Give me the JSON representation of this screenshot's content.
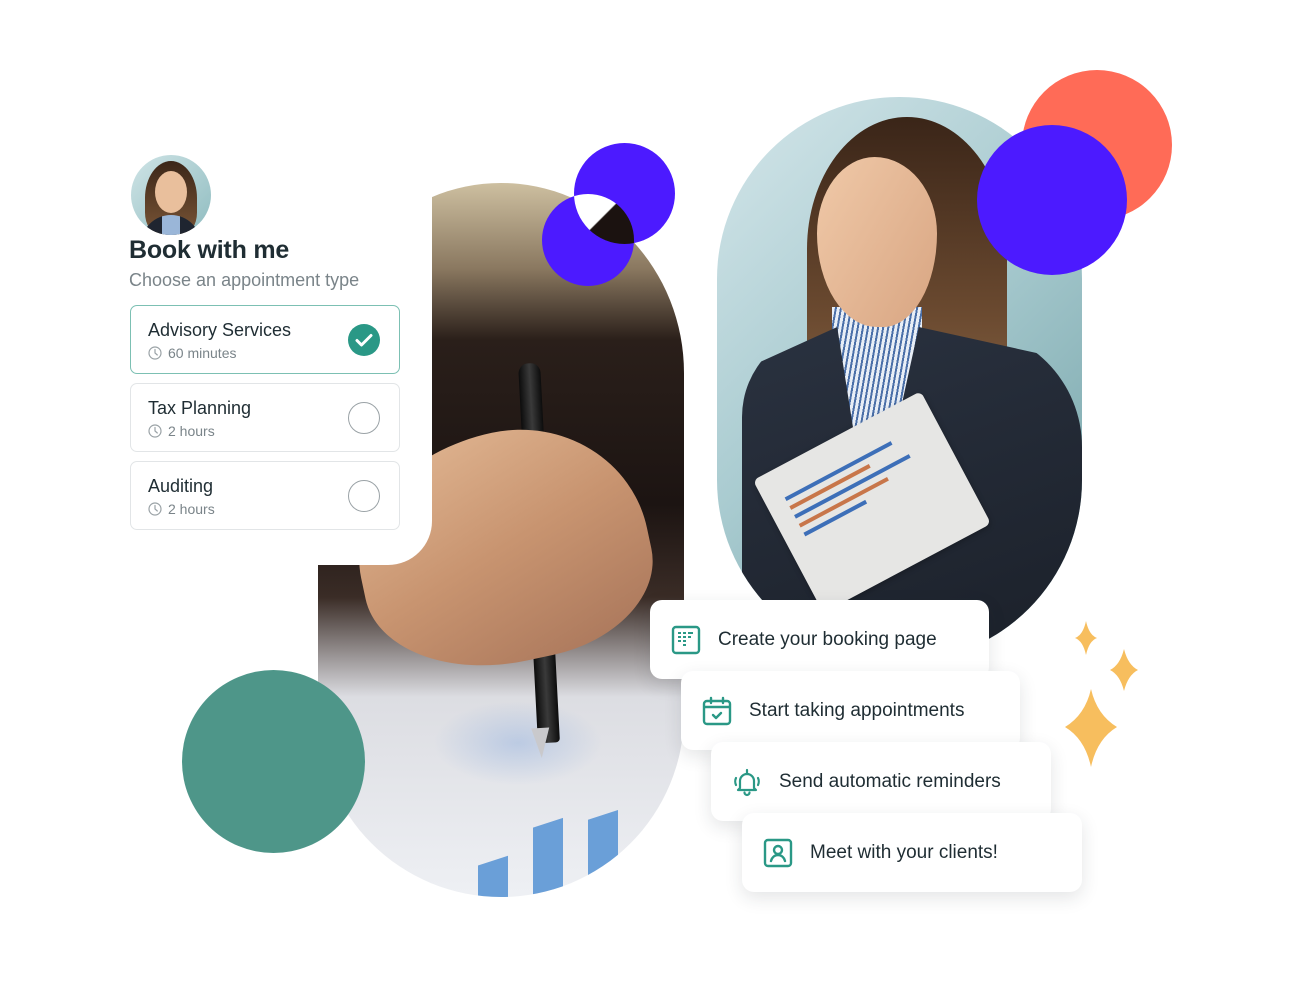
{
  "booking": {
    "title": "Book with me",
    "subtitle": "Choose an appointment type",
    "options": [
      {
        "name": "Advisory Services",
        "duration": "60 minutes",
        "selected": true
      },
      {
        "name": "Tax Planning",
        "duration": "2 hours",
        "selected": false
      },
      {
        "name": "Auditing",
        "duration": "2 hours",
        "selected": false
      }
    ]
  },
  "steps": [
    {
      "label": "Create your booking page",
      "icon": "booking-page-icon"
    },
    {
      "label": "Start taking appointments",
      "icon": "calendar-check-icon"
    },
    {
      "label": "Send automatic reminders",
      "icon": "bell-ringing-icon"
    },
    {
      "label": "Meet with your clients!",
      "icon": "user-portrait-icon"
    }
  ],
  "colors": {
    "accent_teal": "#2a9886",
    "green_circle": "#4e9689",
    "indigo": "#4c1aff",
    "coral": "#ff6b57",
    "sparkle": "#f7be5e",
    "text_dark": "#1f2d33",
    "text_muted": "#7a8489"
  }
}
